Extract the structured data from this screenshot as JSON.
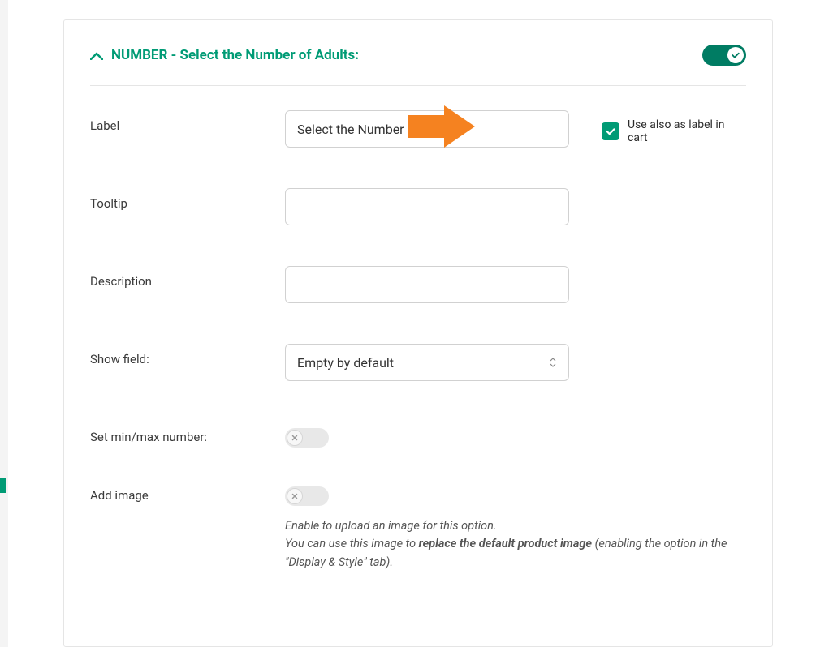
{
  "header": {
    "title": "NUMBER - Select the Number of Adults:",
    "toggle_on": true
  },
  "fields": {
    "label": {
      "field_label": "Label",
      "value": "Select the Number of Adults:",
      "checkbox_label": "Use also as label in cart"
    },
    "tooltip": {
      "field_label": "Tooltip",
      "value": ""
    },
    "description": {
      "field_label": "Description",
      "value": ""
    },
    "show_field": {
      "field_label": "Show field:",
      "selected": "Empty by default"
    },
    "set_minmax": {
      "field_label": "Set min/max number:",
      "on": false
    },
    "add_image": {
      "field_label": "Add image",
      "on": false,
      "helper_line1": "Enable to upload an image for this option.",
      "helper_line2_a": "You can use this image to ",
      "helper_line2_b": "replace the default product image",
      "helper_line2_c": " (enabling the option in the \"Display & Style\" tab)."
    }
  }
}
